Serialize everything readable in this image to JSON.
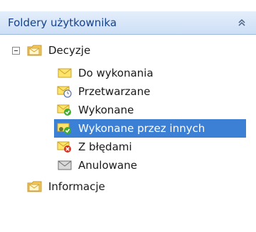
{
  "panel": {
    "title": "Foldery użytkownika",
    "collapse_icon": "double-chevron-up-icon"
  },
  "tree": {
    "root": {
      "label": "Decyzje",
      "icon": "folder-mail-icon",
      "expanded": true,
      "children": [
        {
          "label": "Do wykonania",
          "icon": "envelope-icon"
        },
        {
          "label": "Przetwarzane",
          "icon": "envelope-clock-icon"
        },
        {
          "label": "Wykonane",
          "icon": "envelope-check-icon"
        },
        {
          "label": "Wykonane przez innych",
          "icon": "envelope-check-users-icon",
          "selected": true
        },
        {
          "label": "Z błędami",
          "icon": "envelope-error-icon"
        },
        {
          "label": "Anulowane",
          "icon": "envelope-gray-icon"
        }
      ]
    },
    "second": {
      "label": "Informacje",
      "icon": "folder-mail-icon"
    }
  },
  "colors": {
    "header_text": "#15428b",
    "selection": "#3c80d6"
  }
}
